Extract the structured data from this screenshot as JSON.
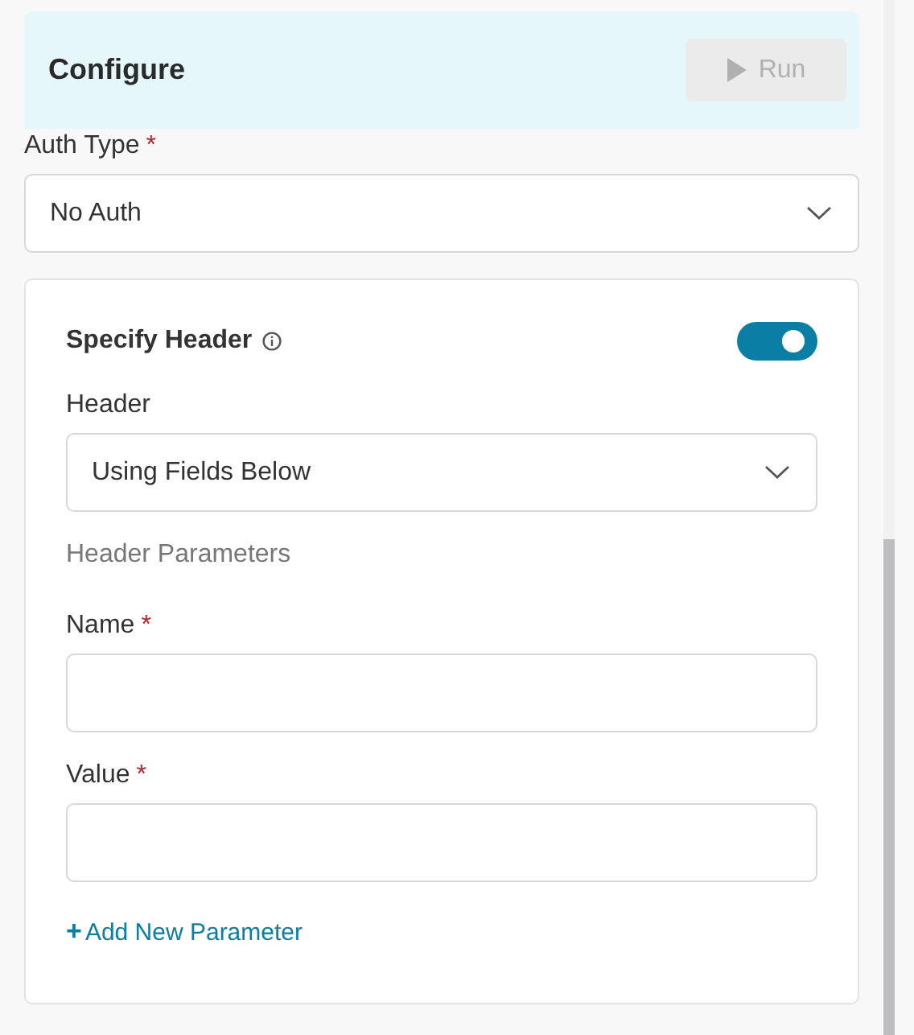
{
  "header": {
    "title": "Configure",
    "run_button": {
      "label": "Run",
      "disabled": true
    }
  },
  "auth_type": {
    "label": "Auth Type",
    "required_mark": "*",
    "value": "No Auth"
  },
  "specify_header": {
    "label": "Specify Header",
    "on": true,
    "header_select": {
      "label": "Header",
      "value": "Using Fields Below"
    },
    "section_label": "Header Parameters",
    "parameters": [
      {
        "label": "Name",
        "required_mark": "*"
      },
      {
        "label": "Value",
        "required_mark": "*"
      }
    ],
    "add_link": {
      "icon": "+",
      "label": "Add New Parameter"
    }
  }
}
